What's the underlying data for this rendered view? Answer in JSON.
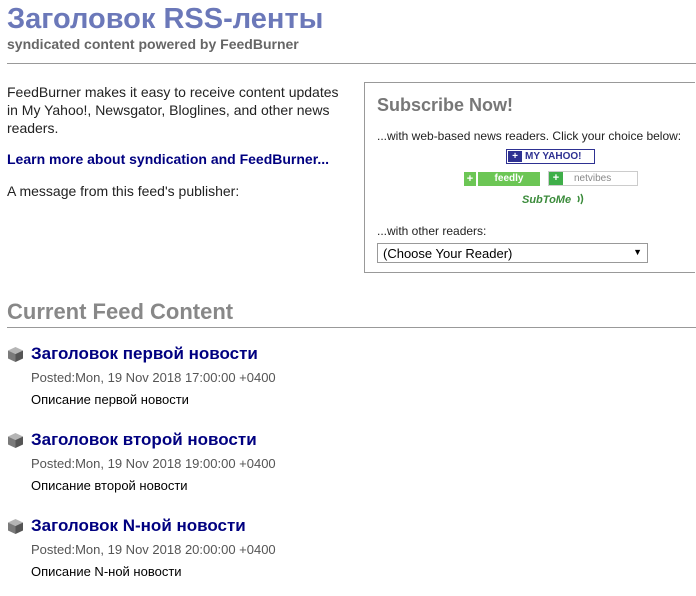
{
  "feed": {
    "title": "Заголовок RSS-ленты",
    "subtitle": "syndicated content powered by FeedBurner"
  },
  "intro": {
    "text": "FeedBurner makes it easy to receive content updates in My Yahoo!, Newsgator, Bloglines, and other news readers.",
    "learn_more_link": "Learn more about syndication and FeedBurner...",
    "publisher_message": "A message from this feed's publisher:"
  },
  "subscribe": {
    "title": "Subscribe Now!",
    "web_readers_text": "...with web-based news readers. Click your choice below:",
    "buttons": {
      "myyahoo": {
        "plus": "+",
        "label": "MY YAHOO!"
      },
      "feedly": {
        "plus": "+",
        "label": "feedly"
      },
      "netvibes": {
        "plus": "+",
        "label": "netvibes"
      },
      "subtome": {
        "label": "SubToMe"
      }
    },
    "other_readers_text": "...with other readers:",
    "reader_select": {
      "selected": "(Choose Your Reader)"
    }
  },
  "current_feed": {
    "heading": "Current Feed Content",
    "items": [
      {
        "title": "Заголовок первой новости",
        "posted_label": "Posted:",
        "date": "Mon, 19 Nov 2018 17:00:00 +0400",
        "description": "Описание первой новости"
      },
      {
        "title": "Заголовок второй новости",
        "posted_label": "Posted:",
        "date": "Mon, 19 Nov 2018 19:00:00 +0400",
        "description": "Описание второй новости"
      },
      {
        "title": "Заголовок N-ной новости",
        "posted_label": "Posted:",
        "date": "Mon, 19 Nov 2018 20:00:00 +0400",
        "description": "Описание N-ной новости"
      }
    ]
  },
  "colors": {
    "title": "#6b78b9",
    "link": "#000080",
    "feedly_green": "#6cc655",
    "yahoo_purple": "#2e3192"
  },
  "icons": {
    "feed_item": "cube-icon",
    "subtome": "signal-waves-icon",
    "select": "dropdown-arrow-icon"
  }
}
